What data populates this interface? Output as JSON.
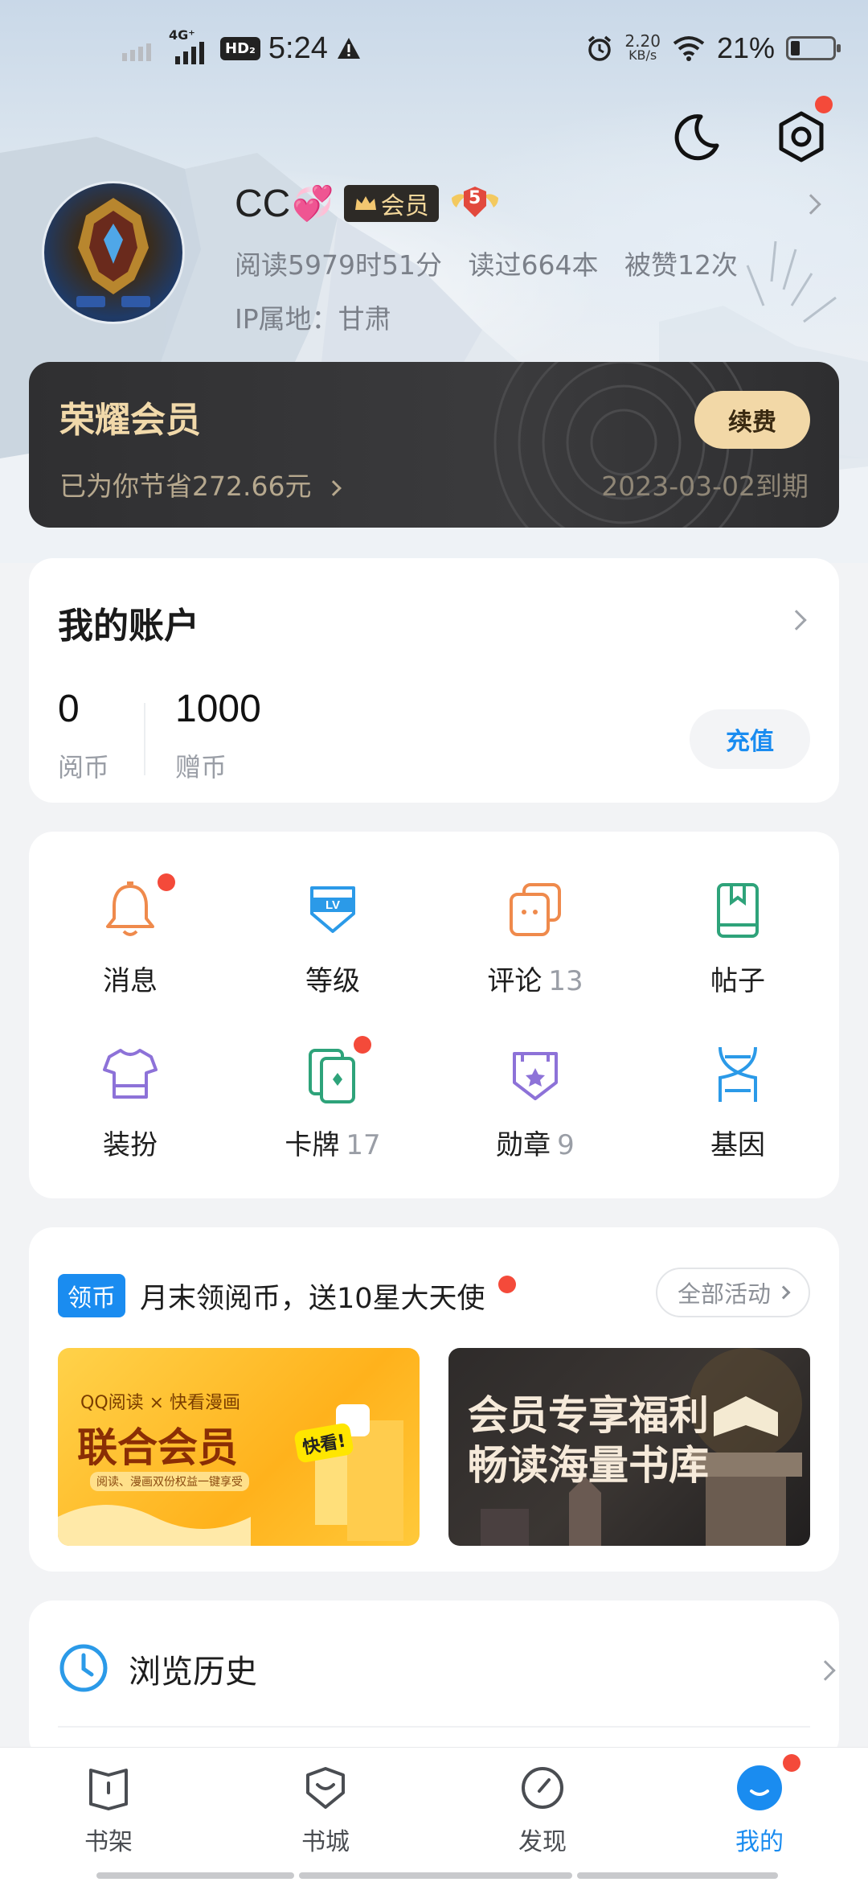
{
  "status_bar": {
    "network": "4G⁺",
    "hd": "HD₂",
    "time": "5:24",
    "speed_value": "2.20",
    "speed_unit": "KB/s",
    "battery": "21%",
    "battery_level": 0.21
  },
  "header": {
    "night_mode_icon": "moon-icon",
    "settings_icon": "gear-icon"
  },
  "profile": {
    "username": "CC",
    "emoji": "💞",
    "vip_label": "会员",
    "level_badge": "5",
    "read_time": "阅读5979时51分",
    "books_read": "读过664本",
    "likes": "被赞12次",
    "ip_location": "IP属地：甘肃"
  },
  "vip_card": {
    "title": "荣耀会员",
    "savings": "已为你节省272.66元",
    "renew_label": "续费",
    "expire": "2023-03-02到期"
  },
  "account": {
    "title": "我的账户",
    "read_coins_value": "0",
    "read_coins_label": "阅币",
    "gift_coins_value": "1000",
    "gift_coins_label": "赠币",
    "recharge_label": "充值"
  },
  "grid": {
    "items": [
      {
        "label": "消息",
        "count": "",
        "icon": "bell-icon"
      },
      {
        "label": "等级",
        "count": "",
        "icon": "level-shield-icon"
      },
      {
        "label": "评论",
        "count": "13",
        "icon": "comment-icon"
      },
      {
        "label": "帖子",
        "count": "",
        "icon": "post-book-icon"
      },
      {
        "label": "装扮",
        "count": "",
        "icon": "tshirt-icon"
      },
      {
        "label": "卡牌",
        "count": "17",
        "icon": "cards-icon"
      },
      {
        "label": "勋章",
        "count": "9",
        "icon": "medal-icon"
      },
      {
        "label": "基因",
        "count": "",
        "icon": "dna-icon"
      }
    ]
  },
  "promo": {
    "tag": "领币",
    "text": "月末领阅币，送10星大天使",
    "all_activities": "全部活动",
    "banner_left": {
      "line1": "QQ阅读 × 快看漫画",
      "line2": "联合会员",
      "line3": "阅读、漫画双份权益一键享受",
      "sticker": "快看!"
    },
    "banner_right": {
      "line1": "会员专享福利",
      "line2": "畅读海量书库"
    }
  },
  "history": {
    "label": "浏览历史"
  },
  "bottom_nav": {
    "items": [
      {
        "label": "书架",
        "icon": "bookshelf-icon"
      },
      {
        "label": "书城",
        "icon": "bookstore-icon"
      },
      {
        "label": "发现",
        "icon": "compass-icon"
      },
      {
        "label": "我的",
        "icon": "profile-face-icon"
      }
    ],
    "active": "我的"
  },
  "colors": {
    "accent": "#1a8cf0",
    "vip_gold": "#f1d9aa",
    "notification": "#f44a3a"
  }
}
